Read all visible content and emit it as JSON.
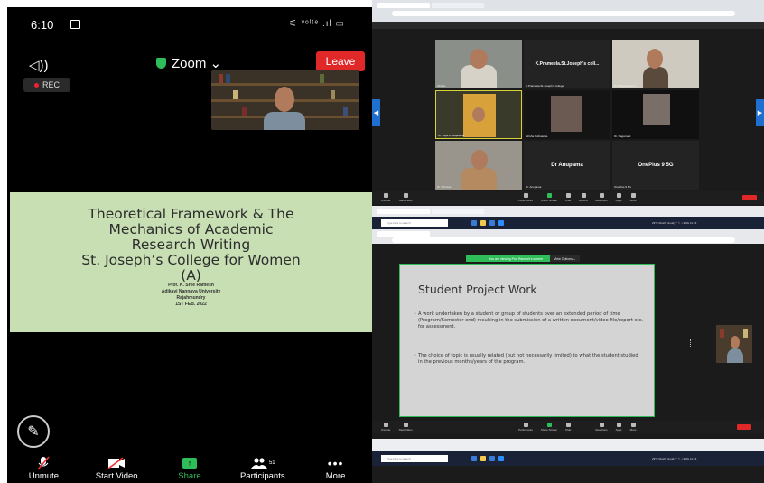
{
  "phone": {
    "time": "6:10",
    "status_right": "⚟ ᵛᵒˡᵗᵉ .ıl ▭",
    "speaker_glyph": "◁))",
    "meeting_title": "Zoom ⌄",
    "leave_label": "Leave",
    "rec_label": "REC",
    "slide": {
      "title_lines": [
        "Theoretical Framework & The",
        "Mechanics of Academic",
        "Research Writing",
        "St. Joseph’s College for Women",
        "(A)"
      ],
      "presenter": "Prof. K. Sree Ramesh",
      "university": "Adikavi Nannaya University",
      "city": "Rajahmundry",
      "date": "1ST FEB. 2022"
    },
    "toolbar": [
      {
        "label": "Unmute",
        "icon": "mic-off-icon"
      },
      {
        "label": "Start Video",
        "icon": "video-off-icon"
      },
      {
        "label": "Share",
        "icon": "share-icon"
      },
      {
        "label": "Participants",
        "icon": "participants-icon",
        "count": "51"
      },
      {
        "label": "More",
        "icon": "more-icon"
      }
    ]
  },
  "zoom_gallery": {
    "tiles": [
      {
        "name": "",
        "label": "Sindhu"
      },
      {
        "name": "K.Prameela.St.Joseph's coll...",
        "label": "K.Prameela.St.Joseph's college"
      },
      {
        "name": "",
        "label": "Dr Bhagyalakshmi"
      },
      {
        "name": "",
        "label": "Dr. Sujai D. Rajasekar"
      },
      {
        "name": "",
        "label": "Sirisha Kothaletha"
      },
      {
        "name": "",
        "label": "Dr. Nagamani"
      },
      {
        "name": "",
        "label": "Dr. Srinivas"
      },
      {
        "name": "",
        "label": "Dr. Anupama"
      },
      {
        "name": "Dr Anupama",
        "label": "Dr Anupama"
      },
      {
        "name": "OnePlus 9 5G",
        "label": "OnePlus 9 5G"
      }
    ],
    "toolbar": [
      "Unmute",
      "Start Video",
      "Participants",
      "Share Screen",
      "Chat",
      "Record",
      "Reactions",
      "Apps",
      "More"
    ]
  },
  "share_view": {
    "banner": "You are viewing Prof Ramesh's screen",
    "view_options": "View Options ⌄",
    "slide_title": "Student Project Work",
    "bullets": [
      "A work undertaken by a student or group of students over an extended period of time (Program/Semester end) resulting in the submission of a written document/video file/report etc. for assessment.",
      "The choice of topic is usually related (but not necessarily limited) to what the student studied in the previous months/years of the program."
    ],
    "search_placeholder": "Type here to search",
    "tray_text": "29°C Mostly cloudy  ^ ⚐ ♪ ENG 11:16"
  }
}
